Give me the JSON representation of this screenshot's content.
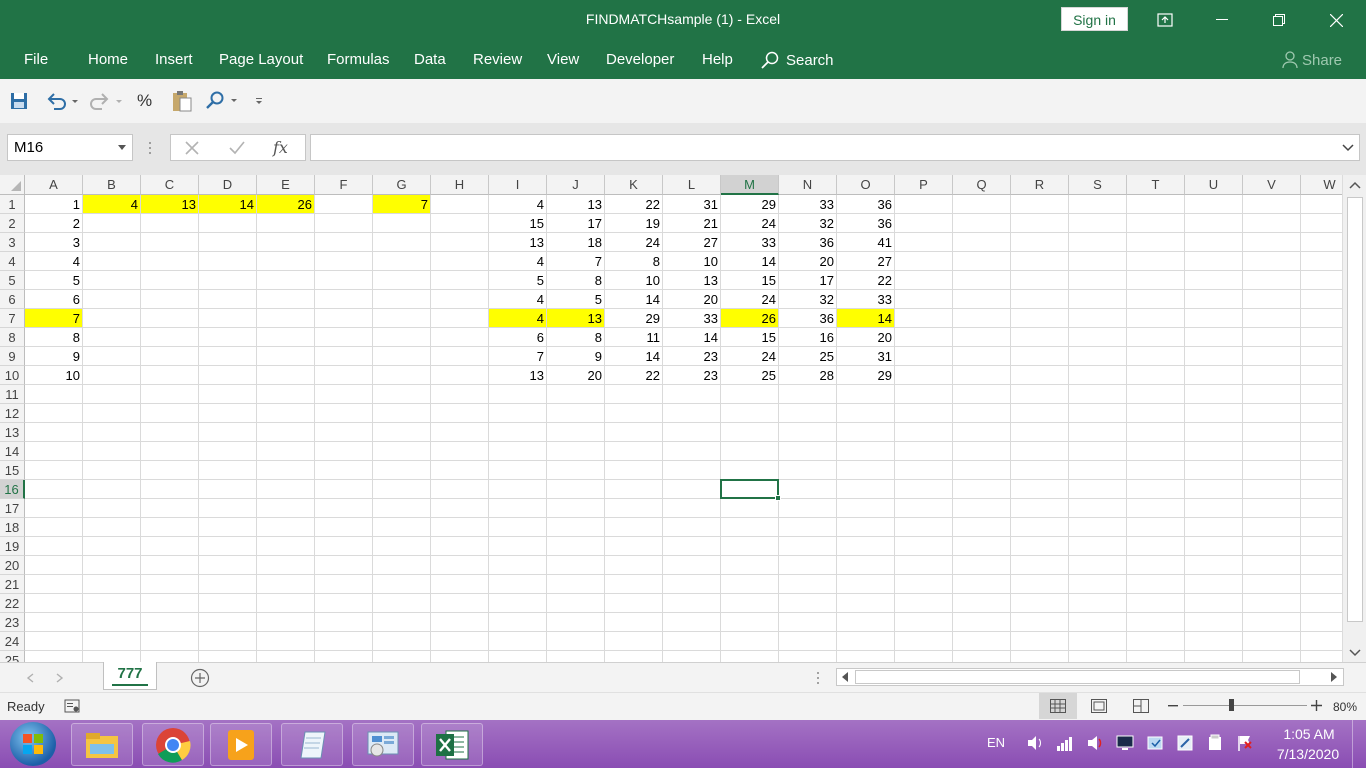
{
  "window": {
    "title": "FINDMATCHsample (1)  -  Excel",
    "sign_in": "Sign in"
  },
  "ribbon": {
    "tabs": [
      "File",
      "Home",
      "Insert",
      "Page Layout",
      "Formulas",
      "Data",
      "Review",
      "View",
      "Developer",
      "Help"
    ],
    "search": "Search",
    "share": "Share"
  },
  "formula_bar": {
    "name_box": "M16",
    "fx": "fx",
    "content": ""
  },
  "grid": {
    "columns": [
      "A",
      "B",
      "C",
      "D",
      "E",
      "F",
      "G",
      "H",
      "I",
      "J",
      "K",
      "L",
      "M",
      "N",
      "O",
      "P",
      "Q",
      "R",
      "S",
      "T",
      "U",
      "V",
      "W"
    ],
    "rows": [
      "1",
      "2",
      "3",
      "4",
      "5",
      "6",
      "7",
      "8",
      "9",
      "10",
      "11",
      "12",
      "13",
      "14",
      "15",
      "16",
      "17",
      "18",
      "19",
      "20",
      "21",
      "22",
      "23",
      "24",
      "25"
    ],
    "active_cell": "M16",
    "highlight_color": "#ffff00",
    "cells": [
      [
        "1",
        "4",
        "13",
        "14",
        "26",
        "",
        "7",
        "",
        "4",
        "13",
        "22",
        "31",
        "29",
        "33",
        "36"
      ],
      [
        "2",
        "",
        "",
        "",
        "",
        "",
        "",
        "",
        "15",
        "17",
        "19",
        "21",
        "24",
        "32",
        "36"
      ],
      [
        "3",
        "",
        "",
        "",
        "",
        "",
        "",
        "",
        "13",
        "18",
        "24",
        "27",
        "33",
        "36",
        "41"
      ],
      [
        "4",
        "",
        "",
        "",
        "",
        "",
        "",
        "",
        "4",
        "7",
        "8",
        "10",
        "14",
        "20",
        "27"
      ],
      [
        "5",
        "",
        "",
        "",
        "",
        "",
        "",
        "",
        "5",
        "8",
        "10",
        "13",
        "15",
        "17",
        "22"
      ],
      [
        "6",
        "",
        "",
        "",
        "",
        "",
        "",
        "",
        "4",
        "5",
        "14",
        "20",
        "24",
        "32",
        "33"
      ],
      [
        "7",
        "",
        "",
        "",
        "",
        "",
        "",
        "",
        "4",
        "13",
        "29",
        "33",
        "26",
        "36",
        "14"
      ],
      [
        "8",
        "",
        "",
        "",
        "",
        "",
        "",
        "",
        "6",
        "8",
        "11",
        "14",
        "15",
        "16",
        "20"
      ],
      [
        "9",
        "",
        "",
        "",
        "",
        "",
        "",
        "",
        "7",
        "9",
        "14",
        "23",
        "24",
        "25",
        "31"
      ],
      [
        "10",
        "",
        "",
        "",
        "",
        "",
        "",
        "",
        "13",
        "20",
        "22",
        "23",
        "25",
        "28",
        "29"
      ]
    ],
    "highlighted": [
      "B1",
      "C1",
      "D1",
      "E1",
      "G1",
      "A7",
      "I7",
      "J7",
      "M7",
      "O7"
    ]
  },
  "sheets": {
    "tabs": [
      "777"
    ],
    "active": "777"
  },
  "status": {
    "text": "Ready",
    "zoom": "80%"
  },
  "taskbar": {
    "lang": "EN",
    "time": "1:05 AM",
    "date": "7/13/2020"
  },
  "colors": {
    "excel_green": "#217346",
    "taskbar": "#9b5fc0"
  }
}
